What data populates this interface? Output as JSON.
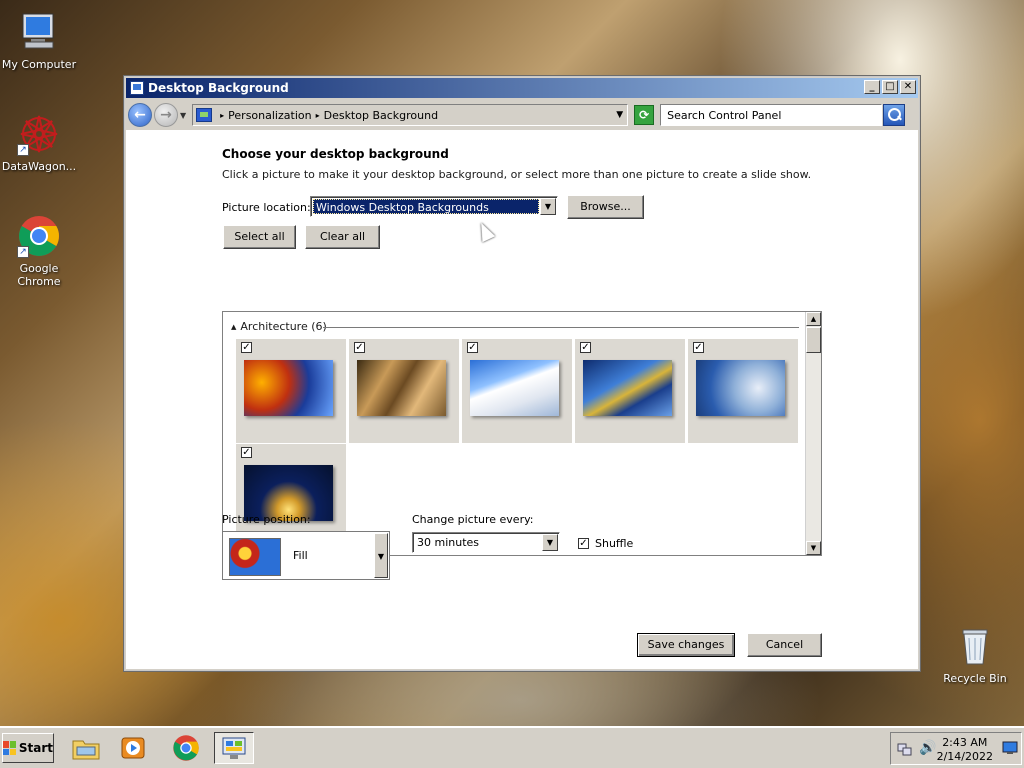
{
  "desktop": {
    "icons": [
      {
        "label": "My Computer"
      },
      {
        "label": "DataWagon..."
      },
      {
        "label": "Google Chrome"
      },
      {
        "label": "Recycle Bin"
      }
    ]
  },
  "window": {
    "title": "Desktop Background",
    "controls": {
      "minimize": "_",
      "maximize": "□",
      "close": "✕"
    },
    "address": {
      "crumbs": [
        "Personalization",
        "Desktop Background"
      ],
      "search_placeholder": "Search Control Panel"
    },
    "heading": "Choose your desktop background",
    "subtext": "Click a picture to make it your desktop background, or select more than one picture to create a slide show.",
    "picture_location": {
      "label": "Picture location:",
      "value": "Windows Desktop Backgrounds"
    },
    "browse_label": "Browse...",
    "select_all_label": "Select all",
    "clear_all_label": "Clear all",
    "gallery": {
      "group_label": "Architecture (6)",
      "items": [
        {
          "checked": true,
          "name": "architecture-1"
        },
        {
          "checked": true,
          "name": "architecture-2"
        },
        {
          "checked": true,
          "name": "architecture-3"
        },
        {
          "checked": true,
          "name": "architecture-4"
        },
        {
          "checked": true,
          "name": "architecture-5"
        },
        {
          "checked": true,
          "name": "architecture-6"
        }
      ]
    },
    "picture_position": {
      "label": "Picture position:",
      "value": "Fill"
    },
    "change_every": {
      "label": "Change picture every:",
      "value": "30 minutes"
    },
    "shuffle": {
      "label": "Shuffle",
      "checked": true
    },
    "save_label": "Save changes",
    "cancel_label": "Cancel"
  },
  "taskbar": {
    "start_label": "Start",
    "clock": {
      "time": "2:43 AM",
      "date": "2/14/2022"
    }
  }
}
